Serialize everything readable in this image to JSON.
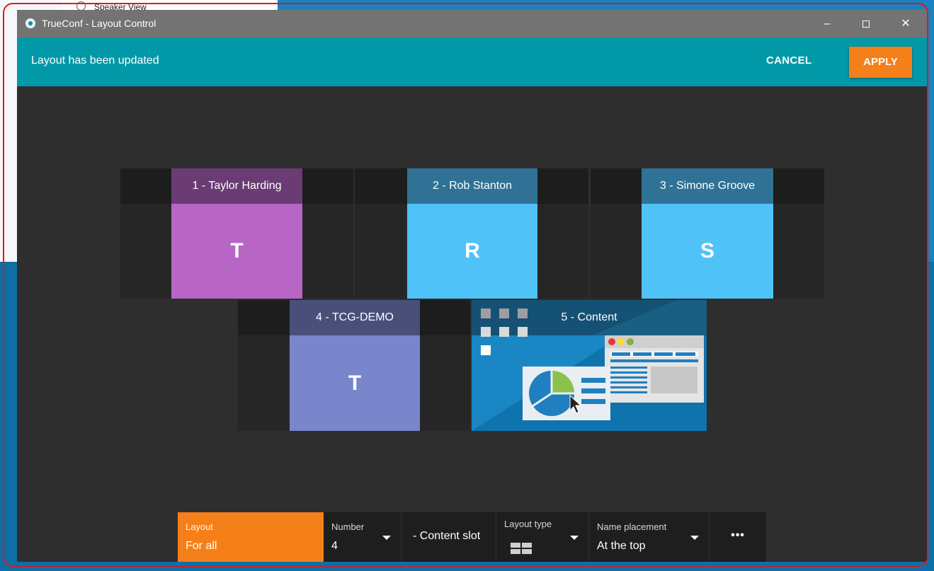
{
  "background": {
    "menu_item": "Speaker View"
  },
  "window": {
    "title": "TrueConf - Layout Control",
    "controls": {
      "minimize": "–",
      "close": "✕"
    }
  },
  "notification": {
    "message": "Layout has been updated",
    "cancel_label": "CANCEL",
    "apply_label": "APPLY"
  },
  "participants": [
    {
      "label": "1 - Taylor Harding",
      "initial": "T",
      "color": "#b766c6"
    },
    {
      "label": "2 - Rob Stanton",
      "initial": "R",
      "color": "#4fc3f7"
    },
    {
      "label": "3 - Simone Groove",
      "initial": "S",
      "color": "#4fc3f7"
    },
    {
      "label": "4 - TCG-DEMO",
      "initial": "T",
      "color": "#7986cb"
    }
  ],
  "content_slot": {
    "label": "5 - Content"
  },
  "toolbar": {
    "layout": {
      "label": "Layout",
      "value": "For all"
    },
    "number": {
      "label": "Number",
      "value": "4"
    },
    "content_slot": {
      "value": "- Content slot"
    },
    "layout_type": {
      "label": "Layout type",
      "icon": "grid-2x2-icon"
    },
    "name_placement": {
      "label": "Name placement",
      "value": "At the top"
    },
    "more": {
      "label": "•••"
    }
  },
  "colors": {
    "accent_teal": "#0199a8",
    "accent_orange": "#f57f19",
    "titlebar": "#737373",
    "canvas": "#2e2e2e"
  }
}
